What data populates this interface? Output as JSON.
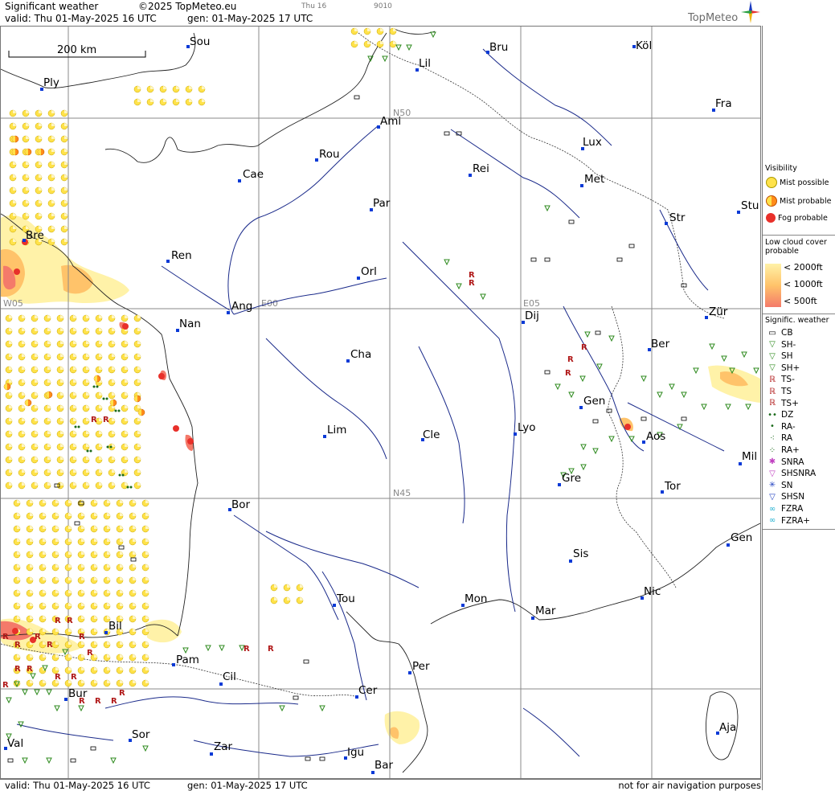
{
  "header": {
    "title": "Significant weather",
    "copyright": "©2025 TopMeteo.eu",
    "day_code": "Thu 16",
    "code": "9010",
    "valid": "valid:  Thu  01-May-2025  16 UTC",
    "generated": "gen:  01-May-2025 17 UTC",
    "brand": "TopMeteo"
  },
  "scale": {
    "label": "200 km"
  },
  "grid_labels": {
    "n50": "N50",
    "n45": "N45",
    "w05": "W05",
    "e00": "E00",
    "e05": "E05"
  },
  "cities": [
    "Sou",
    "Köl",
    "Bru",
    "Lil",
    "Ply",
    "Ami",
    "Fra",
    "Lux",
    "Rou",
    "Cae",
    "Rei",
    "Met",
    "Par",
    "Stu",
    "Str",
    "Bre",
    "Ren",
    "Orl",
    "Ang",
    "Dij",
    "Zür",
    "Nan",
    "Cha",
    "Ber",
    "Gen",
    "Lim",
    "Cle",
    "Lyo",
    "Aos",
    "Mil",
    "Gre",
    "Tor",
    "Bor",
    "Sis",
    "Gen",
    "Tou",
    "Mon",
    "Nic",
    "Mar",
    "Bil",
    "Pam",
    "Per",
    "Cil",
    "Cer",
    "Bur",
    "Sor",
    "Aja",
    "Zar",
    "Val",
    "Igu",
    "Bar"
  ],
  "legend": {
    "visibility_title": "Visibility",
    "mist_possible": "Mist possible",
    "mist_probable": "Mist probable",
    "fog_probable": "Fog probable",
    "low_cloud_title": "Low cloud cover probable",
    "lc_2000": "< 2000ft",
    "lc_1000": "< 1000ft",
    "lc_500": "<   500ft",
    "signific_title": "Signific. weather",
    "items": [
      "CB",
      "SH-",
      "SH",
      "SH+",
      "TS-",
      "TS",
      "TS+",
      "DZ",
      "RA-",
      "RA",
      "RA+",
      "SNRA",
      "SHSNRA",
      "SN",
      "SHSN",
      "FZRA",
      "FZRA+"
    ]
  },
  "colors": {
    "mist_possible": "#ffe24a",
    "mist_probable": "#ff8c1a",
    "fog_probable": "#e8302a",
    "lc_2000": "#fff2a8",
    "lc_1000": "#ffc36a",
    "lc_500": "#f47a6a",
    "rivers": "#1a2a8a",
    "showers": "#2e8a1e",
    "thunder": "#b01818",
    "city_dot": "#0a3ad6"
  },
  "footer": {
    "valid": "valid:  Thu  01-May-2025  16 UTC",
    "generated": "gen:  01-May-2025 17 UTC",
    "disclaimer": "not for air navigation purposes"
  }
}
